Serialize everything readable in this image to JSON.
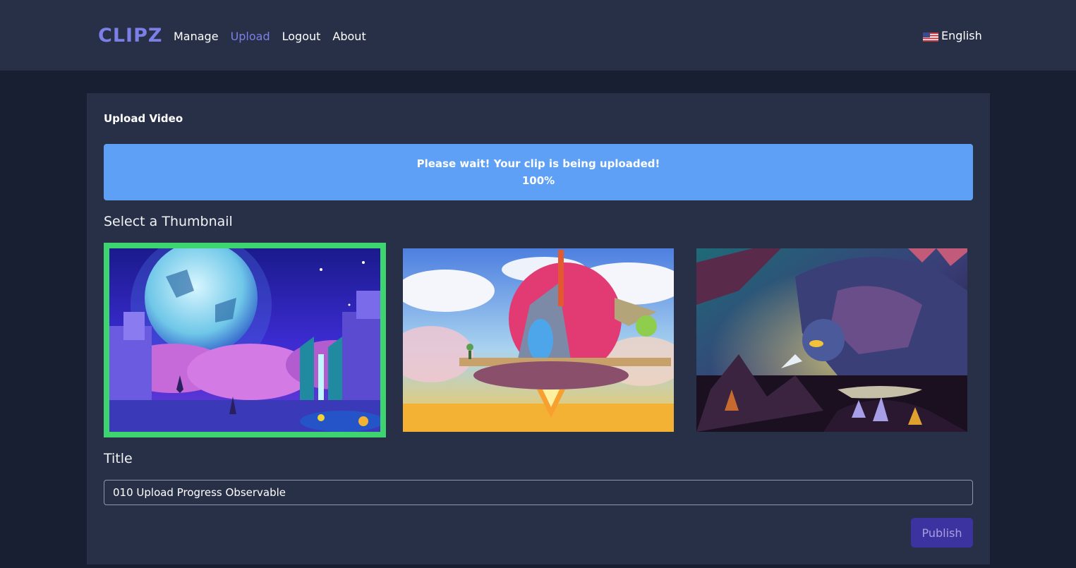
{
  "brand": "CLIPZ",
  "nav": {
    "links": [
      {
        "label": "Manage",
        "active": false
      },
      {
        "label": "Upload",
        "active": true
      },
      {
        "label": "Logout",
        "active": false
      },
      {
        "label": "About",
        "active": false
      }
    ],
    "language": "English",
    "language_icon": "us-flag-icon"
  },
  "upload": {
    "heading": "Upload Video",
    "alert": {
      "message": "Please wait! Your clip is being uploaded!",
      "percent": "100%",
      "color": "#5da0f5"
    },
    "thumbnail_label": "Select a Thumbnail",
    "thumbnails": [
      {
        "name": "moonlit-crystal-landscape",
        "selected": true
      },
      {
        "name": "flying-airship",
        "selected": false
      },
      {
        "name": "dragon",
        "selected": false
      }
    ],
    "selected_color": "#3ed46f",
    "title_label": "Title",
    "title_value": "010 Upload Progress Observable",
    "publish_label": "Publish"
  },
  "colors": {
    "accent": "#7c7fe6",
    "background": "#181f33",
    "panel": "#283048"
  }
}
